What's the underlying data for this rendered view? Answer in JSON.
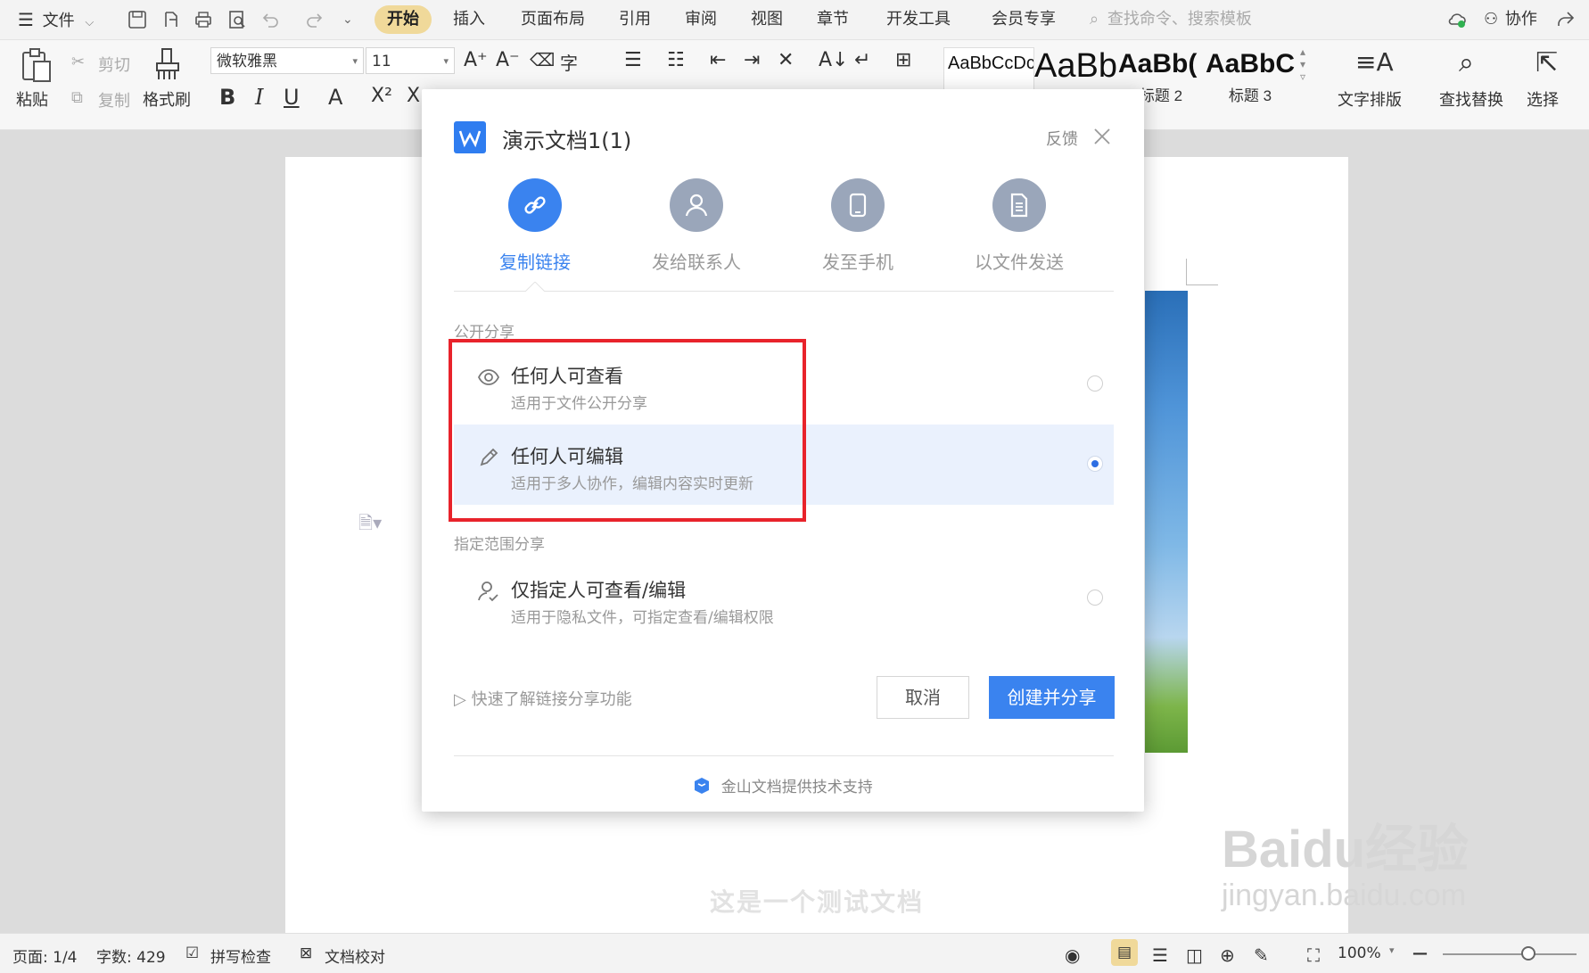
{
  "topbar": {
    "menu_label": "文件",
    "tabs": [
      "开始",
      "插入",
      "页面布局",
      "引用",
      "审阅",
      "视图",
      "章节",
      "开发工具",
      "会员专享"
    ],
    "active_tab": "开始",
    "search_placeholder": "查找命令、搜索模板",
    "collab_label": "协作",
    "icons": [
      "save-icon",
      "export-icon",
      "print-icon",
      "preview-icon",
      "undo-icon",
      "redo-icon",
      "more-icon"
    ]
  },
  "ribbon": {
    "paste": "粘贴",
    "cut": "剪切",
    "copy": "复制",
    "format_painter": "格式刷",
    "font_name": "微软雅黑",
    "font_size": "11",
    "styles": [
      {
        "preview": "AaBbCcDc",
        "label": ""
      },
      {
        "preview": "AaBb",
        "label": ""
      },
      {
        "preview": "AaBb(",
        "label": "标题 2"
      },
      {
        "preview": "AaBbC",
        "label": "标题 3"
      }
    ],
    "text_layout": "文字排版",
    "find_replace": "查找替换",
    "select": "选择"
  },
  "document": {
    "body_text": "这是一个测试文档",
    "watermark_text": "Baidu经验",
    "watermark_url": "jingyan.baidu.com"
  },
  "dialog": {
    "title": "演示文档1(1)",
    "feedback": "反馈",
    "share_options": [
      {
        "label": "复制链接",
        "icon": "link-icon",
        "active": true
      },
      {
        "label": "发给联系人",
        "icon": "contact-icon",
        "active": false
      },
      {
        "label": "发至手机",
        "icon": "phone-icon",
        "active": false
      },
      {
        "label": "以文件发送",
        "icon": "file-icon",
        "active": false
      }
    ],
    "public_section": "公开分享",
    "permissions": [
      {
        "title": "任何人可查看",
        "desc": "适用于文件公开分享",
        "icon": "eye-icon",
        "selected": false
      },
      {
        "title": "任何人可编辑",
        "desc": "适用于多人协作，编辑内容实时更新",
        "icon": "pencil-icon",
        "selected": true
      }
    ],
    "restricted_section": "指定范围分享",
    "restricted": {
      "title": "仅指定人可查看/编辑",
      "desc": "适用于隐私文件，可指定查看/编辑权限",
      "icon": "user-check-icon",
      "selected": false
    },
    "help_link": "快速了解链接分享功能",
    "cancel": "取消",
    "confirm": "创建并分享",
    "powered_by": "金山文档提供技术支持"
  },
  "status": {
    "page": "页面: 1/4",
    "words": "字数: 429",
    "spell": "拼写检查",
    "proof": "文档校对",
    "zoom": "100%"
  },
  "colors": {
    "accent": "#3a83ef",
    "active_tab_bg": "#f0d99a",
    "highlight_border": "#e8232b"
  }
}
